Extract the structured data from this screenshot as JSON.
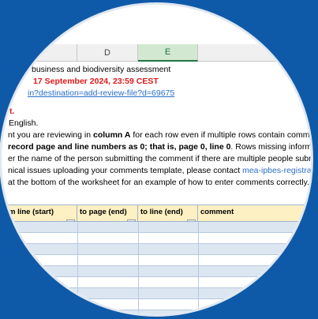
{
  "columns": [
    {
      "letter": "D",
      "selected": false
    },
    {
      "letter": "E",
      "selected": true
    }
  ],
  "notes": {
    "line1": "business and biodiversity assessment",
    "deadline": "17 September 2024, 23:59 CEST",
    "url": "in?destination=add-review-file?d=69675",
    "line4": "t.",
    "line5": "English.",
    "line6_a": "nt you are reviewing in ",
    "line6_b": "column A",
    "line6_c": " for each row even if multiple rows contain comment",
    "line7_a": "record page and line numbers as 0; that is, page 0, line 0",
    "line7_b": ". Rows missing informat.",
    "line8": "er the name of the person submitting the comment if there are multiple people submittii",
    "line9_a": "nical issues uploading your comments template, please contact ",
    "line9_b": "mea-ipbes-registration",
    "line10": "at the bottom of the worksheet for an example of how to enter comments correctly."
  },
  "table_headers": {
    "from_line": "m line (start)",
    "to_page": "to page (end)",
    "to_line": "to line (end)",
    "comment": "comment"
  },
  "icons": {
    "filter": "dropdown-filter-icon"
  },
  "colors": {
    "background": "#0f5aa8",
    "header_fill": "#fdf0c3",
    "deadline": "#e01a1a",
    "link": "#2a6fc9"
  }
}
